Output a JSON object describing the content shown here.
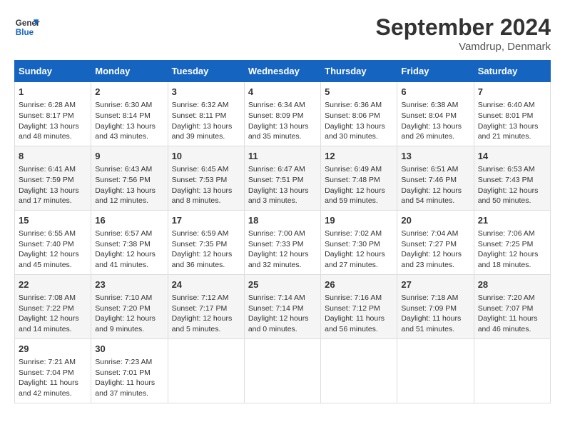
{
  "header": {
    "logo_line1": "General",
    "logo_line2": "Blue",
    "title": "September 2024",
    "location": "Vamdrup, Denmark"
  },
  "weekdays": [
    "Sunday",
    "Monday",
    "Tuesday",
    "Wednesday",
    "Thursday",
    "Friday",
    "Saturday"
  ],
  "weeks": [
    [
      {
        "day": "1",
        "info": "Sunrise: 6:28 AM\nSunset: 8:17 PM\nDaylight: 13 hours\nand 48 minutes."
      },
      {
        "day": "2",
        "info": "Sunrise: 6:30 AM\nSunset: 8:14 PM\nDaylight: 13 hours\nand 43 minutes."
      },
      {
        "day": "3",
        "info": "Sunrise: 6:32 AM\nSunset: 8:11 PM\nDaylight: 13 hours\nand 39 minutes."
      },
      {
        "day": "4",
        "info": "Sunrise: 6:34 AM\nSunset: 8:09 PM\nDaylight: 13 hours\nand 35 minutes."
      },
      {
        "day": "5",
        "info": "Sunrise: 6:36 AM\nSunset: 8:06 PM\nDaylight: 13 hours\nand 30 minutes."
      },
      {
        "day": "6",
        "info": "Sunrise: 6:38 AM\nSunset: 8:04 PM\nDaylight: 13 hours\nand 26 minutes."
      },
      {
        "day": "7",
        "info": "Sunrise: 6:40 AM\nSunset: 8:01 PM\nDaylight: 13 hours\nand 21 minutes."
      }
    ],
    [
      {
        "day": "8",
        "info": "Sunrise: 6:41 AM\nSunset: 7:59 PM\nDaylight: 13 hours\nand 17 minutes."
      },
      {
        "day": "9",
        "info": "Sunrise: 6:43 AM\nSunset: 7:56 PM\nDaylight: 13 hours\nand 12 minutes."
      },
      {
        "day": "10",
        "info": "Sunrise: 6:45 AM\nSunset: 7:53 PM\nDaylight: 13 hours\nand 8 minutes."
      },
      {
        "day": "11",
        "info": "Sunrise: 6:47 AM\nSunset: 7:51 PM\nDaylight: 13 hours\nand 3 minutes."
      },
      {
        "day": "12",
        "info": "Sunrise: 6:49 AM\nSunset: 7:48 PM\nDaylight: 12 hours\nand 59 minutes."
      },
      {
        "day": "13",
        "info": "Sunrise: 6:51 AM\nSunset: 7:46 PM\nDaylight: 12 hours\nand 54 minutes."
      },
      {
        "day": "14",
        "info": "Sunrise: 6:53 AM\nSunset: 7:43 PM\nDaylight: 12 hours\nand 50 minutes."
      }
    ],
    [
      {
        "day": "15",
        "info": "Sunrise: 6:55 AM\nSunset: 7:40 PM\nDaylight: 12 hours\nand 45 minutes."
      },
      {
        "day": "16",
        "info": "Sunrise: 6:57 AM\nSunset: 7:38 PM\nDaylight: 12 hours\nand 41 minutes."
      },
      {
        "day": "17",
        "info": "Sunrise: 6:59 AM\nSunset: 7:35 PM\nDaylight: 12 hours\nand 36 minutes."
      },
      {
        "day": "18",
        "info": "Sunrise: 7:00 AM\nSunset: 7:33 PM\nDaylight: 12 hours\nand 32 minutes."
      },
      {
        "day": "19",
        "info": "Sunrise: 7:02 AM\nSunset: 7:30 PM\nDaylight: 12 hours\nand 27 minutes."
      },
      {
        "day": "20",
        "info": "Sunrise: 7:04 AM\nSunset: 7:27 PM\nDaylight: 12 hours\nand 23 minutes."
      },
      {
        "day": "21",
        "info": "Sunrise: 7:06 AM\nSunset: 7:25 PM\nDaylight: 12 hours\nand 18 minutes."
      }
    ],
    [
      {
        "day": "22",
        "info": "Sunrise: 7:08 AM\nSunset: 7:22 PM\nDaylight: 12 hours\nand 14 minutes."
      },
      {
        "day": "23",
        "info": "Sunrise: 7:10 AM\nSunset: 7:20 PM\nDaylight: 12 hours\nand 9 minutes."
      },
      {
        "day": "24",
        "info": "Sunrise: 7:12 AM\nSunset: 7:17 PM\nDaylight: 12 hours\nand 5 minutes."
      },
      {
        "day": "25",
        "info": "Sunrise: 7:14 AM\nSunset: 7:14 PM\nDaylight: 12 hours\nand 0 minutes."
      },
      {
        "day": "26",
        "info": "Sunrise: 7:16 AM\nSunset: 7:12 PM\nDaylight: 11 hours\nand 56 minutes."
      },
      {
        "day": "27",
        "info": "Sunrise: 7:18 AM\nSunset: 7:09 PM\nDaylight: 11 hours\nand 51 minutes."
      },
      {
        "day": "28",
        "info": "Sunrise: 7:20 AM\nSunset: 7:07 PM\nDaylight: 11 hours\nand 46 minutes."
      }
    ],
    [
      {
        "day": "29",
        "info": "Sunrise: 7:21 AM\nSunset: 7:04 PM\nDaylight: 11 hours\nand 42 minutes."
      },
      {
        "day": "30",
        "info": "Sunrise: 7:23 AM\nSunset: 7:01 PM\nDaylight: 11 hours\nand 37 minutes."
      },
      {
        "day": "",
        "info": ""
      },
      {
        "day": "",
        "info": ""
      },
      {
        "day": "",
        "info": ""
      },
      {
        "day": "",
        "info": ""
      },
      {
        "day": "",
        "info": ""
      }
    ]
  ]
}
